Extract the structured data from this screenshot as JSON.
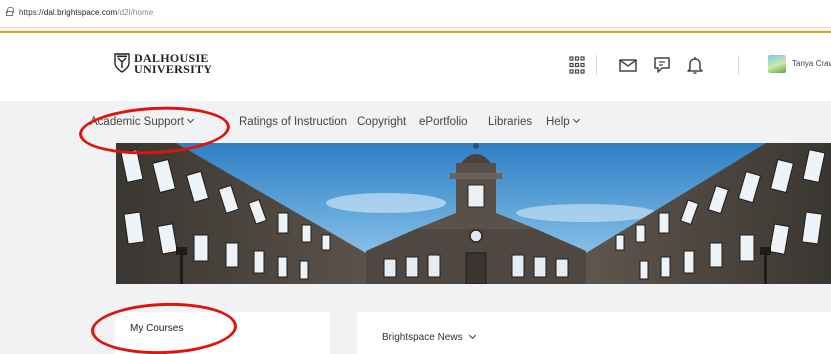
{
  "browser": {
    "url_prefix": "https://",
    "url_host": "dal.brightspace.com",
    "url_path": "/d2l/home"
  },
  "header": {
    "logo_line1": "DALHOUSIE",
    "logo_line2": "UNIVERSITY",
    "icons": [
      "app-grid-icon",
      "mail-icon",
      "chat-icon",
      "bell-icon"
    ],
    "user_name": "Tanya Crawfor"
  },
  "nav": {
    "items": [
      {
        "label": "Academic Support",
        "dropdown": true
      },
      {
        "label": "Ratings of Instruction",
        "dropdown": false
      },
      {
        "label": "Copyright",
        "dropdown": false
      },
      {
        "label": "ePortfolio",
        "dropdown": false
      },
      {
        "label": "Libraries",
        "dropdown": false
      },
      {
        "label": "Help",
        "dropdown": true
      }
    ]
  },
  "widgets": {
    "my_courses": "My Courses",
    "news": "Brightspace News"
  },
  "colors": {
    "accent_gold": "#d4a62a",
    "highlight_red": "#e0130f",
    "sky": "#3f8cc9"
  }
}
